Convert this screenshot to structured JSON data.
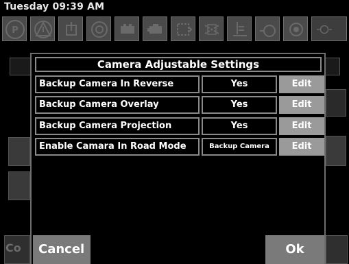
{
  "status": {
    "time": "Tuesday 09:39 AM"
  },
  "background": {
    "bottom_left_text": "Co"
  },
  "warning_icons": [
    "parking-brake-icon",
    "general-warning-icon",
    "coolant-temperature-icon",
    "tire-pressure-icon",
    "battery-icon",
    "engine-icon",
    "transmission-icon",
    "air-filter-icon",
    "fuel-filter-icon",
    "oil-pressure-icon",
    "brake-icon"
  ],
  "dialog": {
    "title": "Camera Adjustable Settings",
    "rows": [
      {
        "label": "Backup Camera In Reverse",
        "value": "Yes",
        "button": "Edit"
      },
      {
        "label": "Backup Camera Overlay",
        "value": "Yes",
        "button": "Edit"
      },
      {
        "label": "Backup Camera Projection",
        "value": "Yes",
        "button": "Edit"
      },
      {
        "label": "Enable Camara In Road Mode",
        "value": "Backup Camera",
        "button": "Edit"
      }
    ],
    "cancel_label": "Cancel",
    "ok_label": "Ok"
  },
  "colors": {
    "background": "#000000",
    "button": "#9a9a9a",
    "border": "#8a8a8a"
  }
}
